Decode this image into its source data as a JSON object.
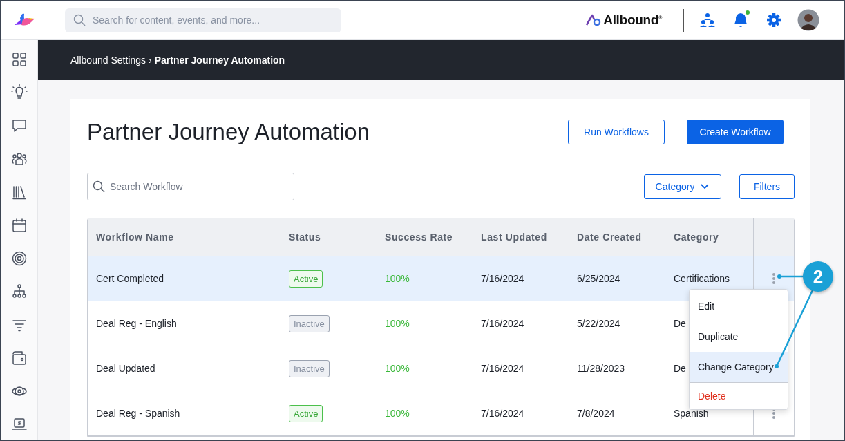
{
  "top_bar": {
    "search": {
      "placeholder": "Search for content, events, and more..."
    },
    "brand": "Allbound$^{®}$",
    "notifications": {
      "unread": true
    }
  },
  "sidebar": {
    "items": [
      {
        "kind": "grid"
      },
      {
        "kind": "bulb"
      },
      {
        "kind": "chat"
      },
      {
        "kind": "people"
      },
      {
        "kind": "library"
      },
      {
        "kind": "calendar"
      },
      {
        "kind": "target"
      },
      {
        "kind": "hierarchy"
      },
      {
        "kind": "funnel"
      },
      {
        "kind": "wallet"
      },
      {
        "kind": "orbit"
      },
      {
        "kind": "laptop"
      }
    ]
  },
  "breadcrumb": {
    "items": [
      "Allbound Settings",
      "Partner Journey Automation"
    ],
    "separator": "›"
  },
  "page": {
    "title": "Partner Journey Automation",
    "buttons": [
      {
        "label": "Run Workflows",
        "kind": "secondary"
      },
      {
        "label": "Create Workflow",
        "kind": "primary"
      }
    ],
    "search": {
      "placeholder": "Search Workflow"
    },
    "category_dropdown": "Category",
    "filters_button": "Filters"
  },
  "table": {
    "columns": [
      "Workflow Name",
      "Status",
      "Success Rate",
      "Last Updated",
      "Date Created",
      "Category"
    ],
    "rows": [
      {
        "name": "Cert Completed",
        "status": {
          "label": "Active",
          "kind": "active"
        },
        "success_rate": "100%",
        "last_updated": "7/16/2024",
        "date_created": "6/25/2024",
        "category": "Certifications",
        "selected": true,
        "actions": true
      },
      {
        "name": "Deal Reg - English",
        "status": {
          "label": "Inactive",
          "kind": "inactive"
        },
        "success_rate": "100%",
        "last_updated": "7/16/2024",
        "date_created": "5/22/2024",
        "category": "De",
        "selected": false,
        "actions": false
      },
      {
        "name": "Deal Updated",
        "status": {
          "label": "Inactive",
          "kind": "inactive"
        },
        "success_rate": "100%",
        "last_updated": "7/16/2024",
        "date_created": "11/28/2023",
        "category": "De",
        "selected": false,
        "actions": false
      },
      {
        "name": "Deal Reg - Spanish",
        "status": {
          "label": "Active",
          "kind": "active"
        },
        "success_rate": "100%",
        "last_updated": "7/16/2024",
        "date_created": "7/8/2024",
        "category": "Spanish",
        "selected": false,
        "actions": true
      }
    ]
  },
  "row_menu": {
    "items": [
      {
        "label": "Edit",
        "kind": "normal",
        "selected": false
      },
      {
        "label": "Duplicate",
        "kind": "normal",
        "selected": false
      },
      {
        "label": "Change Category",
        "kind": "normal",
        "selected": true
      },
      {
        "label": "Delete",
        "kind": "danger",
        "selected": false
      }
    ]
  },
  "callout": {
    "label": "2"
  }
}
